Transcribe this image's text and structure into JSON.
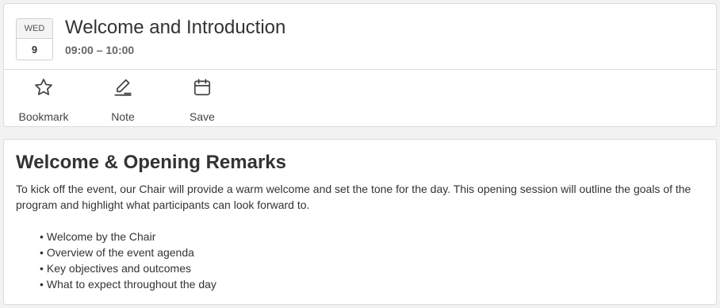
{
  "session": {
    "date": {
      "weekday": "WED",
      "day": "9"
    },
    "title": "Welcome and Introduction",
    "time": "09:00 – 10:00"
  },
  "actions": [
    {
      "label": "Bookmark",
      "icon": "star-icon"
    },
    {
      "label": "Note",
      "icon": "pencil-icon"
    },
    {
      "label": "Save",
      "icon": "calendar-icon"
    }
  ],
  "details": {
    "heading": "Welcome & Opening Remarks",
    "description": "To kick off the event, our Chair will provide a warm welcome and set the tone for the day. This opening session will outline the goals of the program and highlight what participants can look forward to.",
    "bullets": [
      "Welcome by the Chair",
      "Overview of the event agenda",
      "Key objectives and outcomes",
      "What to expect throughout the day"
    ]
  }
}
